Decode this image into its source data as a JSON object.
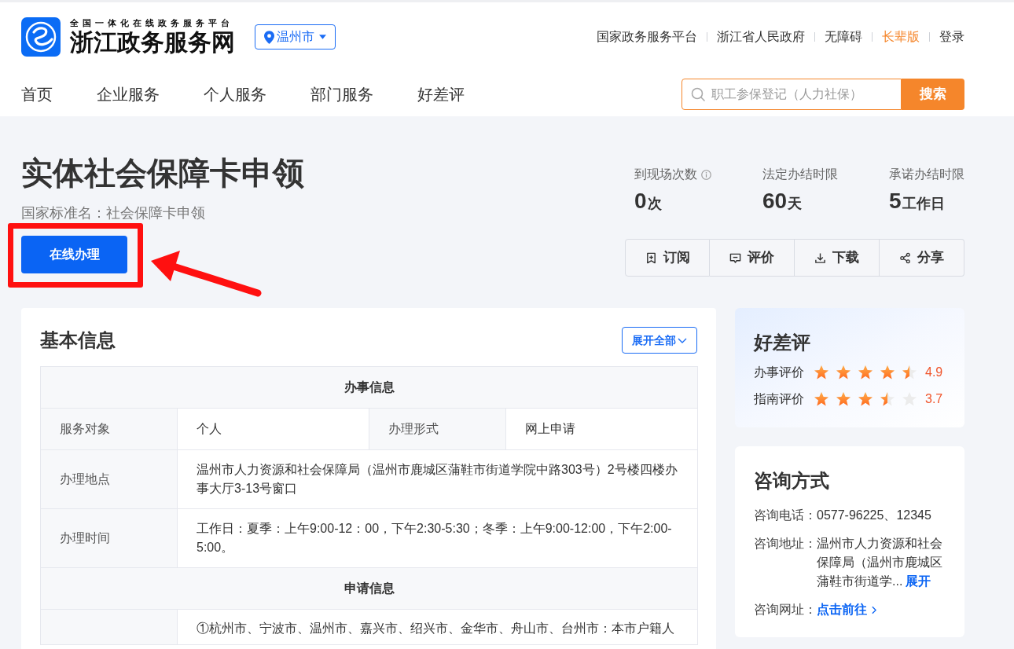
{
  "header": {
    "logo": {
      "tagline": "全国一体化在线政务服务平台",
      "title": "浙江政务服务网"
    },
    "city": "温州市",
    "top_links": [
      {
        "label": "国家政务服务平台",
        "highlighted": false
      },
      {
        "label": "浙江省人民政府",
        "highlighted": false
      },
      {
        "label": "无障碍",
        "highlighted": false
      },
      {
        "label": "长辈版",
        "highlighted": true
      },
      {
        "label": "登录",
        "highlighted": false
      }
    ]
  },
  "nav": [
    "首页",
    "企业服务",
    "个人服务",
    "部门服务",
    "好差评"
  ],
  "search": {
    "placeholder": "职工参保登记（人力社保）",
    "button": "搜索"
  },
  "service": {
    "title": "实体社会保障卡申领",
    "standard_name": "国家标准名：社会保障卡申领",
    "apply_button": "在线办理",
    "stats": [
      {
        "label": "到现场次数",
        "info": true,
        "value": "0",
        "unit": "次"
      },
      {
        "label": "法定办结时限",
        "info": false,
        "value": "60",
        "unit": "天"
      },
      {
        "label": "承诺办结时限",
        "info": false,
        "value": "5",
        "unit": "工作日"
      }
    ],
    "actions": [
      "订阅",
      "评价",
      "下载",
      "分享"
    ]
  },
  "basic_info": {
    "title": "基本信息",
    "expand_button": "展开全部",
    "sections": [
      {
        "heading": "办事信息",
        "rows": [
          [
            {
              "label": "服务对象",
              "value": "个人"
            },
            {
              "label": "办理形式",
              "value": "网上申请"
            }
          ],
          [
            {
              "label": "办理地点",
              "value": "温州市人力资源和社会保障局（温州市鹿城区蒲鞋市街道学院中路303号）2号楼四楼办事大厅3-13号窗口"
            }
          ],
          [
            {
              "label": "办理时间",
              "value": "工作日：夏季：上午9:00-12：00，下午2:30-5:30；冬季：上午9:00-12:00，下午2:00-5:00。"
            }
          ]
        ]
      },
      {
        "heading": "申请信息",
        "rows": [
          [
            {
              "value": "①杭州市、宁波市、温州市、嘉兴市、绍兴市、金华市、舟山市、台州市：本市户籍人"
            }
          ]
        ]
      }
    ]
  },
  "rating": {
    "title": "好差评",
    "items": [
      {
        "label": "办事评价",
        "stars": 4.5,
        "score": "4.9"
      },
      {
        "label": "指南评价",
        "stars": 3.5,
        "score": "3.7"
      }
    ]
  },
  "contact": {
    "title": "咨询方式",
    "items": [
      {
        "label": "咨询电话：",
        "value": "0577-96225、12345"
      },
      {
        "label": "咨询地址：",
        "value": "温州市人力资源和社会保障局（温州市鹿城区蒲鞋市街道学...",
        "link": "展开"
      },
      {
        "label": "咨询网址：",
        "link": "点击前往"
      }
    ]
  }
}
